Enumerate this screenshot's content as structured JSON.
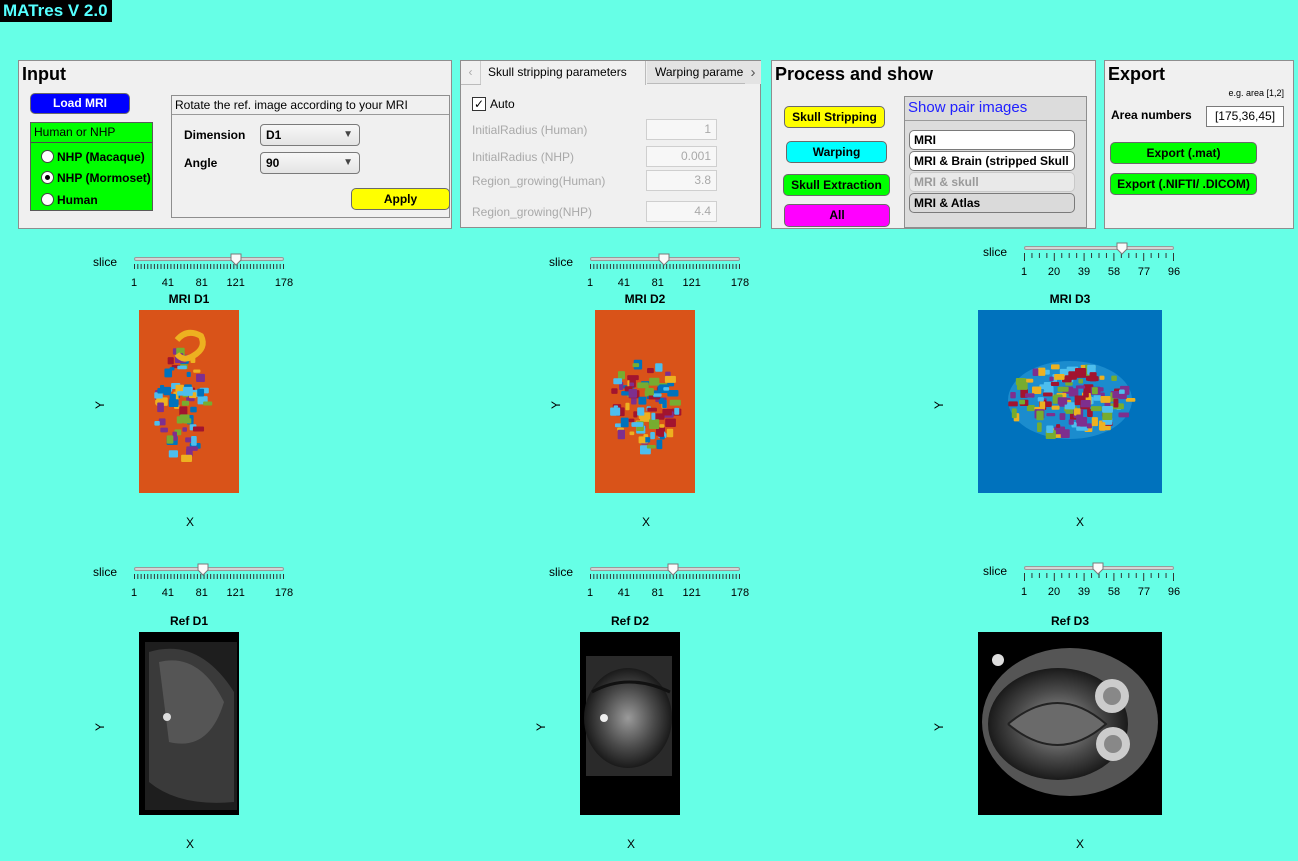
{
  "app": {
    "title": "MATres V 2.0"
  },
  "colors": {
    "background": "#66FFE6",
    "orange_bg": "#D95319",
    "blue_bg": "#0072BD",
    "green": "#00FF00",
    "yellow": "#FFFF00",
    "cyan": "#00FFFF",
    "magenta": "#FF00FF",
    "load_blue": "#0000FF"
  },
  "input_panel": {
    "title": "Input",
    "load_button": "Load MRI",
    "species_group": {
      "title": "Human or NHP",
      "options": [
        "NHP (Macaque)",
        "NHP (Mormoset)",
        "Human"
      ],
      "selected": "NHP (Mormoset)"
    },
    "rotate_box": {
      "title": "Rotate the ref. image according to your MRI",
      "dimension_label": "Dimension",
      "dimension_value": "D1",
      "angle_label": "Angle",
      "angle_value": "90",
      "apply_button": "Apply"
    }
  },
  "params_panel": {
    "tabs": [
      "Skull stripping parameters",
      "Warping parame"
    ],
    "active_tab": "Skull stripping parameters",
    "auto_label": "Auto",
    "auto_checked": true,
    "params": [
      {
        "label": "InitialRadius (Human)",
        "value": "1"
      },
      {
        "label": "InitialRadius (NHP)",
        "value": "0.001"
      },
      {
        "label": "Region_growing(Human)",
        "value": "3.8"
      },
      {
        "label": "Region_growing(NHP)",
        "value": "4.4"
      }
    ]
  },
  "process_panel": {
    "title": "Process and show",
    "buttons": {
      "skull_stripping": "Skull Stripping",
      "warping": "Warping",
      "skull_extraction": "Skull Extraction",
      "all": "All"
    },
    "pair_list": {
      "title": "Show pair images",
      "items": [
        "MRI",
        "MRI & Brain (stripped Skull )",
        "MRI & skull",
        "MRI & Atlas"
      ],
      "selected": "MRI & Atlas"
    }
  },
  "export_panel": {
    "title": "Export",
    "hint": "e.g. area [1,2]",
    "area_label": "Area numbers",
    "area_value": "[175,36,45]",
    "export_mat": "Export (.mat)",
    "export_nifti": "Export (.NIFTI/ .DICOM)"
  },
  "views": [
    {
      "id": "mri-d1",
      "title": "MRI  D1",
      "slice_label": "slice",
      "ticks": [
        "1",
        "41",
        "81",
        "121",
        "178"
      ],
      "slice_value": 121,
      "slice_max": 178,
      "xlabel": "X",
      "ylabel": "Y"
    },
    {
      "id": "mri-d2",
      "title": "MRI  D2",
      "slice_label": "slice",
      "ticks": [
        "1",
        "41",
        "81",
        "121",
        "178"
      ],
      "slice_value": 88,
      "slice_max": 178,
      "xlabel": "X",
      "ylabel": "Y"
    },
    {
      "id": "mri-d3",
      "title": "MRI  D3",
      "slice_label": "slice",
      "ticks": [
        "1",
        "20",
        "39",
        "58",
        "77",
        "96"
      ],
      "slice_value": 63,
      "slice_max": 96,
      "xlabel": "X",
      "ylabel": "Y"
    },
    {
      "id": "ref-d1",
      "title": "Ref  D1",
      "slice_label": "slice",
      "ticks": [
        "1",
        "41",
        "81",
        "121",
        "178"
      ],
      "slice_value": 82,
      "slice_max": 178,
      "xlabel": "X",
      "ylabel": "Y"
    },
    {
      "id": "ref-d2",
      "title": "Ref  D2",
      "slice_label": "slice",
      "ticks": [
        "1",
        "41",
        "81",
        "121",
        "178"
      ],
      "slice_value": 99,
      "slice_max": 178,
      "xlabel": "X",
      "ylabel": "Y"
    },
    {
      "id": "ref-d3",
      "title": "Ref  D3",
      "slice_label": "slice",
      "ticks": [
        "1",
        "20",
        "39",
        "58",
        "77",
        "96"
      ],
      "slice_value": 48,
      "slice_max": 96,
      "xlabel": "X",
      "ylabel": "Y"
    }
  ]
}
